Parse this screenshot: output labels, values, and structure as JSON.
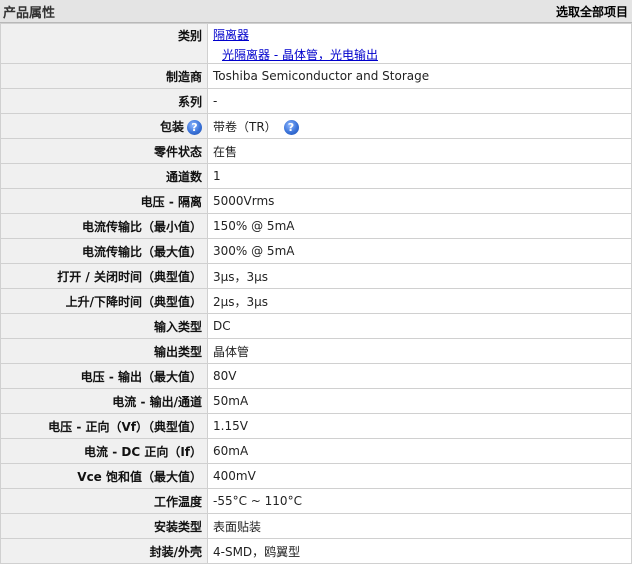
{
  "header": {
    "title": "产品属性",
    "select_all": "选取全部项目"
  },
  "category": {
    "label": "类别",
    "link1": "隔离器",
    "link2": "光隔离器 - 晶体管，光电输出"
  },
  "manufacturer": {
    "label": "制造商",
    "value": "Toshiba Semiconductor and Storage"
  },
  "series": {
    "label": "系列",
    "value": "-"
  },
  "packaging": {
    "label": "包装",
    "value": "带卷（TR）",
    "help_glyph": "?"
  },
  "part_status": {
    "label": "零件状态",
    "value": "在售"
  },
  "channels": {
    "label": "通道数",
    "value": "1"
  },
  "isolation_voltage": {
    "label": "电压 - 隔离",
    "value": "5000Vrms"
  },
  "ctr_min": {
    "label": "电流传输比（最小值）",
    "value": "150% @ 5mA"
  },
  "ctr_max": {
    "label": "电流传输比（最大值）",
    "value": "300% @ 5mA"
  },
  "on_off_time": {
    "label": "打开 / 关闭时间（典型值）",
    "value": "3µs，3µs"
  },
  "rise_fall_time": {
    "label": "上升/下降时间（典型值）",
    "value": "2µs，3µs"
  },
  "input_type": {
    "label": "输入类型",
    "value": "DC"
  },
  "output_type": {
    "label": "输出类型",
    "value": "晶体管"
  },
  "output_voltage_max": {
    "label": "电压 - 输出（最大值）",
    "value": "80V"
  },
  "output_current": {
    "label": "电流 - 输出/通道",
    "value": "50mA"
  },
  "forward_voltage": {
    "label": "电压 - 正向（Vf）（典型值）",
    "value": "1.15V"
  },
  "dc_forward_current": {
    "label": "电流 - DC 正向（If）",
    "value": "60mA"
  },
  "vce_sat": {
    "label": "Vce 饱和值（最大值）",
    "value": "400mV"
  },
  "operating_temp": {
    "label": "工作温度",
    "value": "-55°C ~ 110°C"
  },
  "mounting_type": {
    "label": "安装类型",
    "value": "表面贴装"
  },
  "package_case": {
    "label": "封装/外壳",
    "value": "4-SMD，鸥翼型"
  }
}
